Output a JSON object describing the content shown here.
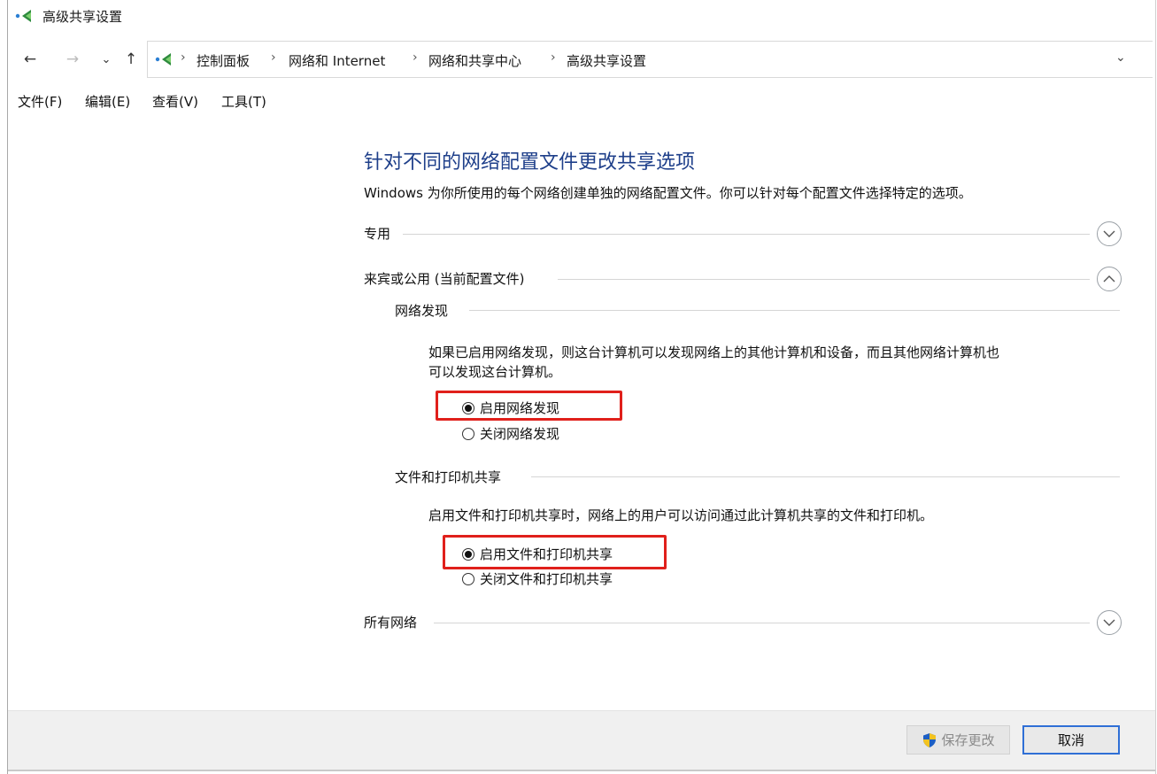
{
  "window": {
    "title": "高级共享设置"
  },
  "address": {
    "breadcrumbs": [
      "控制面板",
      "网络和 Internet",
      "网络和共享中心",
      "高级共享设置"
    ],
    "separator": "›"
  },
  "nav": {
    "back": "←",
    "forward": "→",
    "recent": "⌄",
    "up": "↑",
    "dropdown": "⌄"
  },
  "menu": [
    "文件(F)",
    "编辑(E)",
    "查看(V)",
    "工具(T)"
  ],
  "content": {
    "heading": "针对不同的网络配置文件更改共享选项",
    "description": "Windows 为你所使用的每个网络创建单独的网络配置文件。你可以针对每个配置文件选择特定的选项。",
    "profiles": {
      "private": {
        "label": "专用",
        "expanded": false
      },
      "guest": {
        "label": "来宾或公用 (当前配置文件)",
        "expanded": true,
        "discovery": {
          "label": "网络发现",
          "text_line1": "如果已启用网络发现，则这台计算机可以发现网络上的其他计算机和设备，而且其他网络计算机也",
          "text_line2": "可以发现这台计算机。",
          "on_label": "启用网络发现",
          "off_label": "关闭网络发现",
          "selected": "on"
        },
        "sharing": {
          "label": "文件和打印机共享",
          "text": "启用文件和打印机共享时，网络上的用户可以访问通过此计算机共享的文件和打印机。",
          "on_label": "启用文件和打印机共享",
          "off_label": "关闭文件和打印机共享",
          "selected": "on"
        }
      },
      "all": {
        "label": "所有网络",
        "expanded": false
      }
    }
  },
  "footer": {
    "save_label": "保存更改",
    "cancel_label": "取消"
  },
  "colors": {
    "heading": "#1e3f8a",
    "highlight": "#e0201b",
    "focus": "#2f6fd6",
    "shield_blue": "#1d5fc4",
    "shield_yellow": "#f3c320"
  }
}
